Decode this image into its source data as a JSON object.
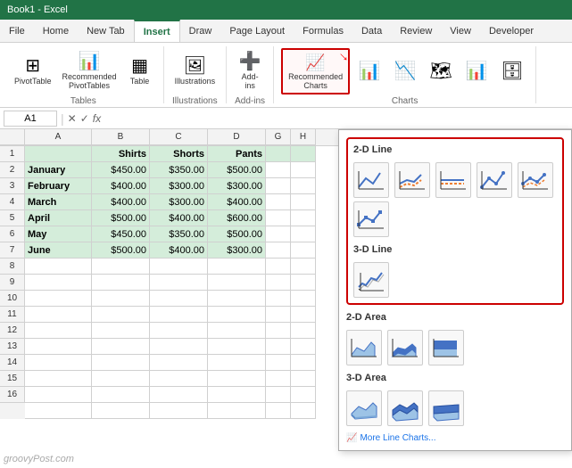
{
  "titlebar": {
    "text": "Book1 - Excel"
  },
  "ribbon": {
    "tabs": [
      "File",
      "Home",
      "New Tab",
      "Insert",
      "Draw",
      "Page Layout",
      "Formulas",
      "Data",
      "Review",
      "View",
      "Developer"
    ],
    "active_tab": "Insert",
    "groups": {
      "tables": {
        "label": "Tables",
        "buttons": [
          "PivotTable",
          "Recommended PivotTables",
          "Table"
        ]
      },
      "illustrations": {
        "label": "Illustrations",
        "buttons": [
          "Illustrations"
        ]
      },
      "add_ins": {
        "label": "Add-ins",
        "buttons": [
          "Add-ins"
        ]
      },
      "charts": {
        "recommended_label": "Recommended Charts"
      }
    }
  },
  "formula_bar": {
    "name_box": "A1",
    "formula": ""
  },
  "spreadsheet": {
    "columns": [
      "A",
      "B",
      "C",
      "D",
      "G",
      "H"
    ],
    "headers": [
      "",
      "Shirts",
      "Shorts",
      "Pants"
    ],
    "rows": [
      {
        "month": "January",
        "shirts": "$450.00",
        "shorts": "$350.00",
        "pants": "$500.00"
      },
      {
        "month": "February",
        "shirts": "$400.00",
        "shorts": "$300.00",
        "pants": "$300.00"
      },
      {
        "month": "March",
        "shirts": "$400.00",
        "shorts": "$300.00",
        "pants": "$400.00"
      },
      {
        "month": "April",
        "shirts": "$500.00",
        "shorts": "$400.00",
        "pants": "$600.00"
      },
      {
        "month": "May",
        "shirts": "$450.00",
        "shorts": "$350.00",
        "pants": "$500.00"
      },
      {
        "month": "June",
        "shirts": "$500.00",
        "shorts": "$400.00",
        "pants": "$300.00"
      }
    ],
    "row_numbers": [
      "1",
      "2",
      "3",
      "4",
      "5",
      "6",
      "7",
      "8",
      "9",
      "10",
      "11",
      "12",
      "13",
      "14",
      "15",
      "16"
    ]
  },
  "chart_panel": {
    "sections": [
      {
        "title": "2-D Line",
        "highlighted": true,
        "charts": [
          {
            "name": "Line",
            "type": "line-basic"
          },
          {
            "name": "Stacked Line",
            "type": "line-stacked"
          },
          {
            "name": "100% Stacked Line",
            "type": "line-100"
          },
          {
            "name": "Line with Markers",
            "type": "line-markers"
          },
          {
            "name": "Stacked Line with Markers",
            "type": "line-stacked-markers"
          }
        ],
        "extra_row": [
          {
            "name": "Line with Markers 2",
            "type": "line-markers-2"
          }
        ]
      },
      {
        "title": "3-D Line",
        "highlighted": true,
        "charts": [
          {
            "name": "3D Line",
            "type": "line-3d"
          }
        ]
      },
      {
        "title": "2-D Area",
        "highlighted": false,
        "charts": [
          {
            "name": "Area",
            "type": "area-basic"
          },
          {
            "name": "Stacked Area",
            "type": "area-stacked"
          },
          {
            "name": "100% Stacked Area",
            "type": "area-100"
          }
        ]
      },
      {
        "title": "3-D Area",
        "highlighted": false,
        "charts": [
          {
            "name": "3D Area",
            "type": "area-3d-basic"
          },
          {
            "name": "3D Stacked Area",
            "type": "area-3d-stacked"
          },
          {
            "name": "3D 100% Stacked Area",
            "type": "area-3d-100"
          }
        ]
      }
    ],
    "more_link": "More Line Charts..."
  },
  "watermark": "groovyPost.com"
}
